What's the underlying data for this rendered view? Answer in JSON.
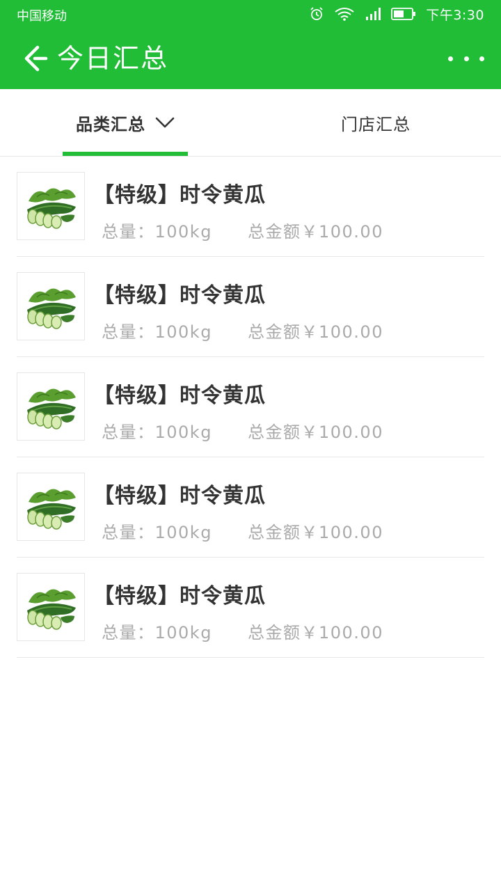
{
  "status_bar": {
    "carrier": "中国移动",
    "time": "下午3:30"
  },
  "navbar": {
    "title": "今日汇总"
  },
  "tabs": [
    {
      "label": "品类汇总",
      "active": true
    },
    {
      "label": "门店汇总",
      "active": false
    }
  ],
  "colors": {
    "primary": "#21bd37",
    "text": "#333333",
    "muted": "#aaaaaa"
  },
  "items": [
    {
      "title": "【特级】时令黄瓜",
      "qty": "总量：100kg",
      "amount": "总金额￥100.00",
      "image": "cucumber-image"
    },
    {
      "title": "【特级】时令黄瓜",
      "qty": "总量：100kg",
      "amount": "总金额￥100.00",
      "image": "cucumber-image"
    },
    {
      "title": "【特级】时令黄瓜",
      "qty": "总量：100kg",
      "amount": "总金额￥100.00",
      "image": "cucumber-image"
    },
    {
      "title": "【特级】时令黄瓜",
      "qty": "总量：100kg",
      "amount": "总金额￥100.00",
      "image": "cucumber-image"
    },
    {
      "title": "【特级】时令黄瓜",
      "qty": "总量：100kg",
      "amount": "总金额￥100.00",
      "image": "cucumber-image"
    }
  ]
}
